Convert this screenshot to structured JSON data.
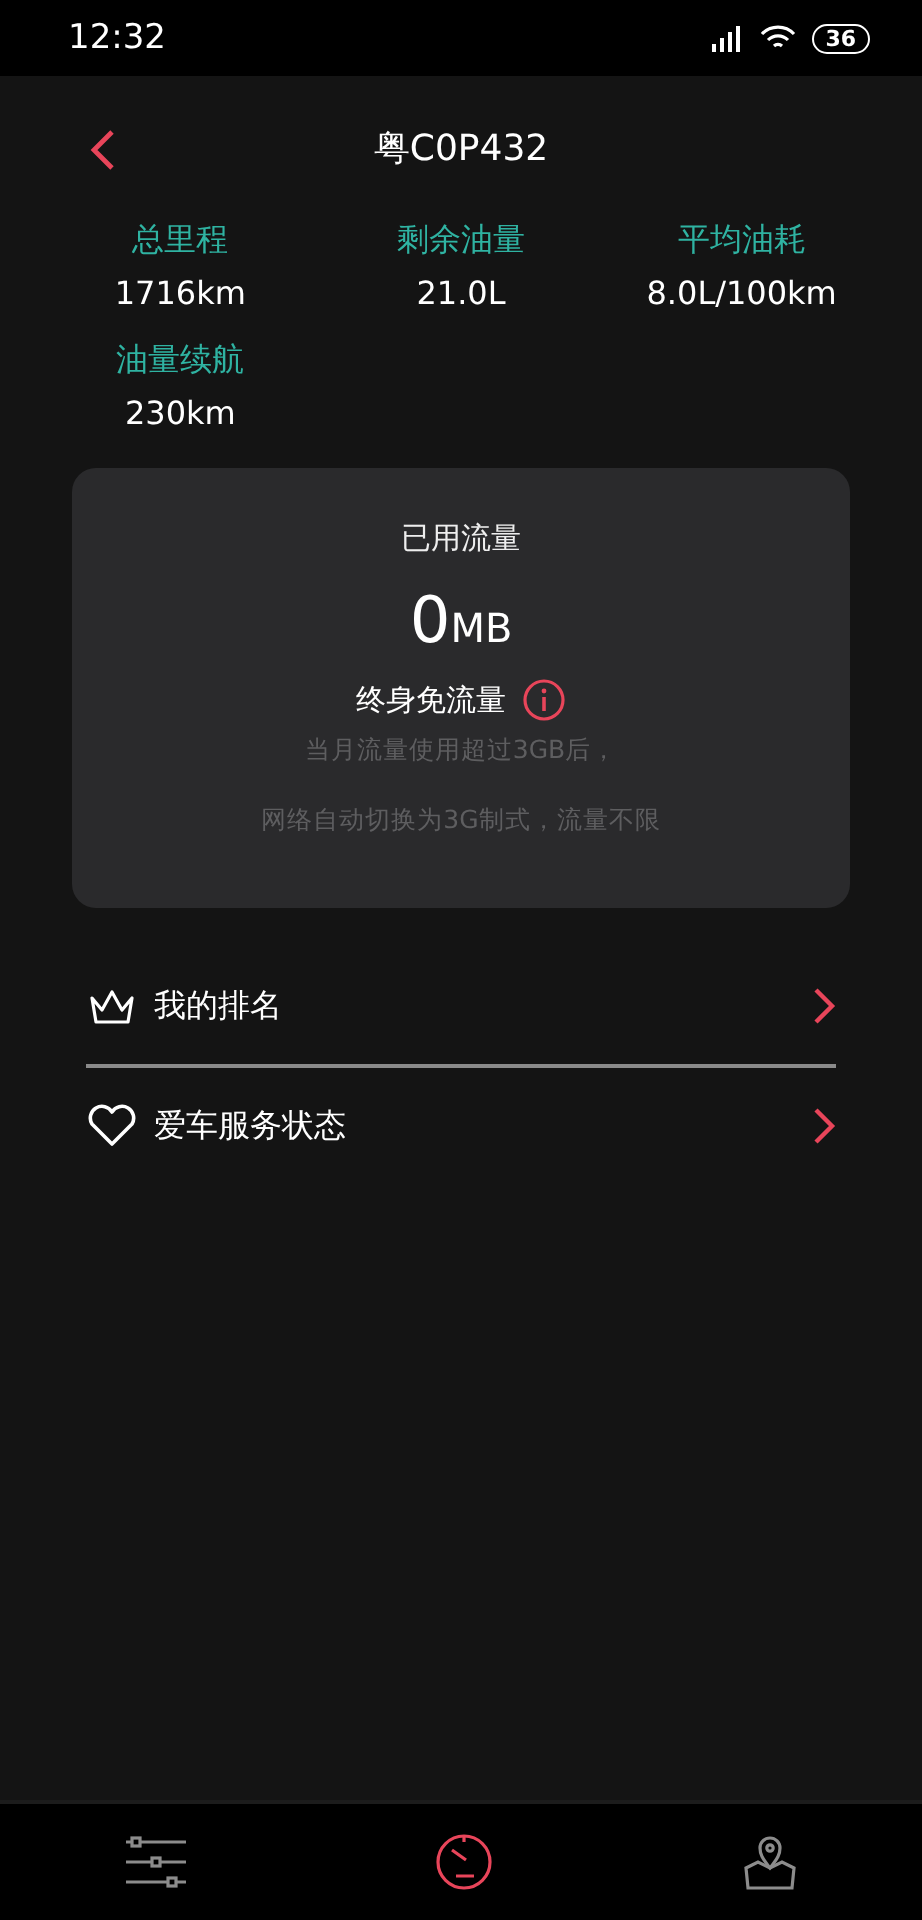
{
  "status_bar": {
    "time": "12:32",
    "battery": "36"
  },
  "header": {
    "title": "粤C0P432"
  },
  "stats": [
    {
      "label": "总里程",
      "value": "1716km"
    },
    {
      "label": "剩余油量",
      "value": "21.0L"
    },
    {
      "label": "平均油耗",
      "value": "8.0L/100km"
    },
    {
      "label": "油量续航",
      "value": "230km"
    }
  ],
  "data_card": {
    "title": "已用流量",
    "amount": "0",
    "unit": "MB",
    "plan": "终身免流量",
    "note_lines": [
      "当月流量使用超过3GB后，",
      "网络自动切换为3G制式，流量不限"
    ]
  },
  "menu": [
    {
      "kind": "crown",
      "label": "我的排名"
    },
    {
      "kind": "heart",
      "label": "爱车服务状态"
    }
  ],
  "bottom_nav": [
    {
      "kind": "sliders",
      "selected": false
    },
    {
      "kind": "gauge",
      "selected": true
    },
    {
      "kind": "map",
      "selected": false
    }
  ]
}
